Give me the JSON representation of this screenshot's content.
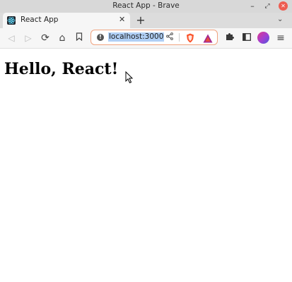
{
  "window": {
    "title": "React App - Brave",
    "minimize_glyph": "–",
    "maximize_glyph": "⤢",
    "close_glyph": "✕"
  },
  "tabs": [
    {
      "label": "React App",
      "favicon": "react-icon",
      "close_glyph": "✕",
      "active": true
    }
  ],
  "tabstrip": {
    "new_tab_glyph": "+",
    "tab_list_glyph": "⌄"
  },
  "toolbar": {
    "back_glyph": "◁",
    "forward_glyph": "▷",
    "reload_glyph": "⟳",
    "home_glyph": "⌂",
    "bookmark_glyph": "🔖",
    "extensions_glyph": "🧩",
    "sidebar_glyph": "▭",
    "menu_glyph": "≡"
  },
  "address_bar": {
    "url": "localhost:3000",
    "info_glyph": "!",
    "share_glyph": "<"
  },
  "page": {
    "heading": "Hello, React!"
  },
  "colors": {
    "address_border": "#f0a37f",
    "url_selection": "#b0cff5",
    "brave_shield": "#fb542b",
    "window_close": "#ee5d52"
  }
}
